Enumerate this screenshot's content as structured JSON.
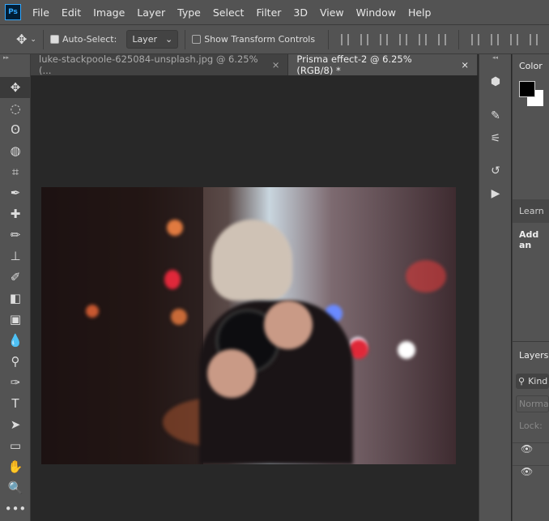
{
  "app": {
    "logo": "Ps"
  },
  "menu": [
    "File",
    "Edit",
    "Image",
    "Layer",
    "Type",
    "Select",
    "Filter",
    "3D",
    "View",
    "Window",
    "Help"
  ],
  "options": {
    "auto_select_label": "Auto-Select:",
    "auto_select_checked": true,
    "layer_select": "Layer",
    "show_transform_label": "Show Transform Controls",
    "show_transform_checked": false
  },
  "tabs": [
    {
      "label": "luke-stackpoole-625084-unsplash.jpg @ 6.25% (...",
      "close": "×",
      "active": false
    },
    {
      "label": "Prisma effect-2 @ 6.25% (RGB/8) *",
      "close": "×",
      "active": true
    }
  ],
  "tools": [
    "move",
    "marquee",
    "lasso",
    "quick-select",
    "crop",
    "eyedropper",
    "healing",
    "brush",
    "stamp",
    "history-brush",
    "eraser",
    "gradient",
    "blur",
    "dodge",
    "pen",
    "type",
    "path-select",
    "rectangle",
    "hand",
    "zoom",
    "more"
  ],
  "panels": {
    "color_title": "Color",
    "learn_title": "Learn",
    "learn_text": "Add an",
    "layers_title": "Layers",
    "kind_label": "Kind",
    "blend_mode": "Normal",
    "lock_label": "Lock:"
  },
  "colors": {
    "foreground": "#000000",
    "background": "#ffffff",
    "accent": "#31a8ff"
  }
}
